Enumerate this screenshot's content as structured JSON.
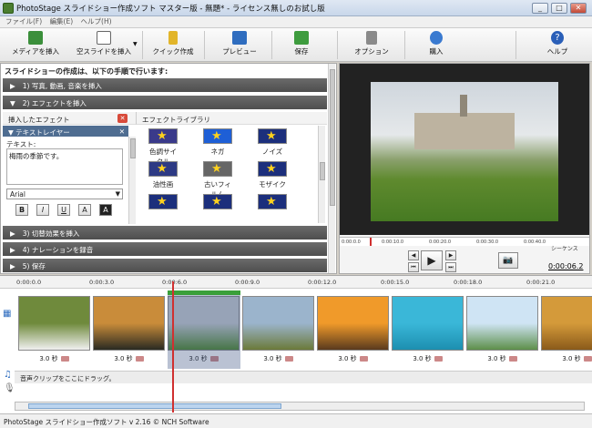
{
  "window": {
    "title": "PhotoStage スライドショー作成ソフト マスター版 - 無題* - ライセンス無しのお試し版",
    "minimize": "_",
    "maximize": "□",
    "close": "✕"
  },
  "menu": [
    "ファイル(F)",
    "編集(E)",
    "ヘルプ(H)"
  ],
  "toolbar": {
    "media": "メディアを挿入",
    "blank": "空スライドを挿入",
    "quick": "クイック作成",
    "preview": "プレビュー",
    "save": "保存",
    "options": "オプション",
    "buy": "購入",
    "help": "ヘルプ"
  },
  "steps": {
    "title": "スライドショーの作成は、以下の手順で行います:",
    "items": [
      {
        "num": "1)",
        "label": "写真, 動画, 音楽を挿入",
        "arrow": "▶"
      },
      {
        "num": "2)",
        "label": "エフェクトを挿入",
        "arrow": "▼"
      },
      {
        "num": "3)",
        "label": "切替効果を挿入",
        "arrow": "▶"
      },
      {
        "num": "4)",
        "label": "ナレーションを録音",
        "arrow": "▶"
      },
      {
        "num": "5)",
        "label": "保存",
        "arrow": "▶"
      }
    ]
  },
  "effects": {
    "inserted_header": "挿入したエフェクト",
    "delete": "✕",
    "selected_item": "テキストレイヤー",
    "text_label": "テキスト:",
    "text_value": "梅雨の季節です。",
    "font": "Arial",
    "format_buttons": [
      "B",
      "I",
      "U",
      "A",
      "A"
    ],
    "library_header": "エフェクトライブラリ",
    "library": [
      {
        "label": "色調サイクル",
        "color": "#3a3a8a"
      },
      {
        "label": "ネガ",
        "color": "#1e5fd6"
      },
      {
        "label": "ノイズ",
        "color": "#1c2f7c"
      },
      {
        "label": "油性画",
        "color": "#2d3a84"
      },
      {
        "label": "古いフィルム",
        "color": "#666666"
      },
      {
        "label": "モザイク",
        "color": "#1c2f7c"
      },
      {
        "label": "",
        "color": "#1c2f7c"
      },
      {
        "label": "",
        "color": "#1c2f7c"
      },
      {
        "label": "",
        "color": "#1c2f7c"
      }
    ]
  },
  "preview": {
    "ticks": [
      "0:00:0.0",
      "0:00:10.0",
      "0:00:20.0",
      "0:00:30.0",
      "0:00:40.0"
    ],
    "scene": "シーケンス",
    "timecode": "0:00:06.2"
  },
  "timeline": {
    "ruler": [
      "0:00:0.0",
      "0:00:3.0",
      "0:00:6.0",
      "0:00:9.0",
      "0:00:12.0",
      "0:00:15.0",
      "0:00:18.0",
      "0:00:21.0"
    ],
    "clips": [
      {
        "duration": "3.0 秒",
        "desc": "panda",
        "c1": "#6f8a3c",
        "c2": "#f0f0f0"
      },
      {
        "duration": "3.0 秒",
        "desc": "tiger",
        "c1": "#c98c3a",
        "c2": "#2a2a22"
      },
      {
        "duration": "3.0 秒",
        "desc": "castle",
        "c1": "#c9cfd4",
        "c2": "#4f8a2a"
      },
      {
        "duration": "3.0 秒",
        "desc": "marsh",
        "c1": "#9bb4cc",
        "c2": "#6b7a3a"
      },
      {
        "duration": "3.0 秒",
        "desc": "sunset",
        "c1": "#f09a2a",
        "c2": "#5a3a1e"
      },
      {
        "duration": "3.0 秒",
        "desc": "beach",
        "c1": "#3ab7d8",
        "c2": "#1d8fb0"
      },
      {
        "duration": "3.0 秒",
        "desc": "mountains",
        "c1": "#cfe4f4",
        "c2": "#5d8f4a"
      },
      {
        "duration": "3.0 秒",
        "desc": "autumn",
        "c1": "#d49a3a",
        "c2": "#8a5a1a"
      }
    ],
    "audio_hint": "音声クリップをここにドラッグ。"
  },
  "status": "PhotoStage スライドショー作成ソフト v 2.16 © NCH Software"
}
